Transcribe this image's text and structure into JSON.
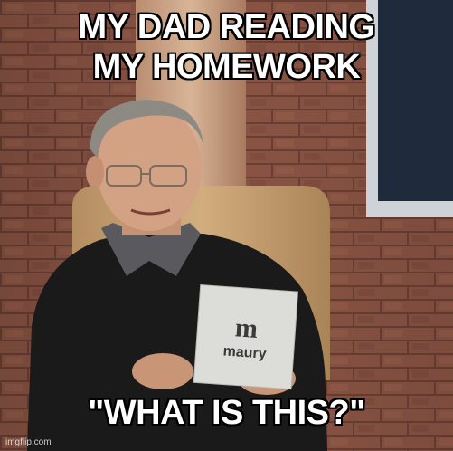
{
  "meme": {
    "top_text": "MY DAD READING\nMY HOMEWORK",
    "top_line_1": "MY DAD READING",
    "top_line_2": "MY HOMEWORK",
    "bottom_text": "\"WHAT IS THIS?\"",
    "watermark": "imgflip.com",
    "card_logo": "maury"
  },
  "colors": {
    "brick": "#8a5444",
    "mortar": "#6b3f33",
    "chair": "#c7a173",
    "sweater": "#1a1a1a",
    "card": "#d9d9d6",
    "window": "#1f2a3c",
    "text_fill": "#ffffff",
    "text_outline": "#000000"
  }
}
